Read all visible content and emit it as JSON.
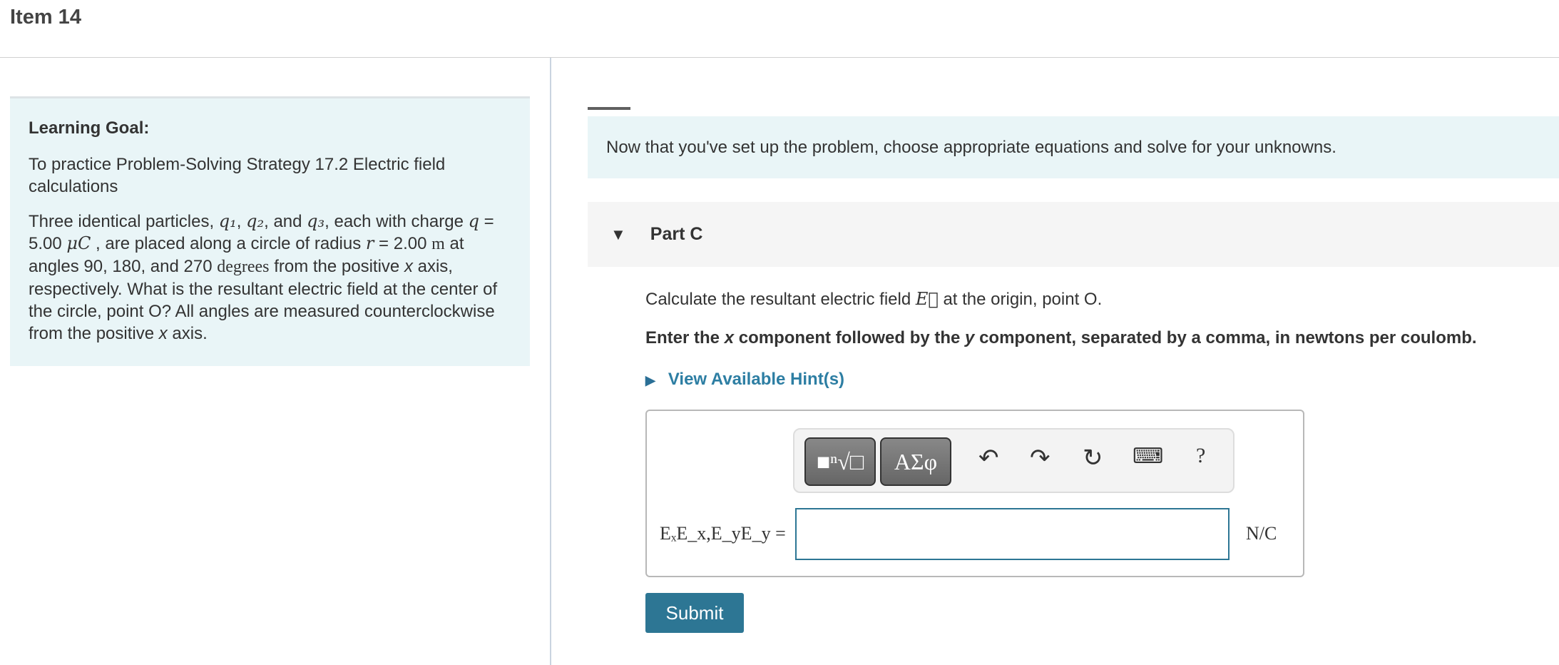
{
  "header": {
    "title": "Item 14"
  },
  "learning_goal": {
    "heading": "Learning Goal:",
    "intro": "To practice Problem-Solving Strategy 17.2 Electric field calculations",
    "problem": {
      "p1": "Three identical particles, ",
      "q1": "q₁",
      "c1": ", ",
      "q2": "q₂",
      "c2": ", and ",
      "q3": "q₃",
      "p2": ", each with charge ",
      "q": "q",
      "p3": " = 5.00 ",
      "unit_c": "μC",
      "p4": " , are placed along a circle of radius ",
      "r": "r",
      "p5": " = 2.00 ",
      "m": "m",
      "p6": " at angles 90, 180, and 270 ",
      "deg": "degrees",
      "p7": " from the positive ",
      "x": "x",
      "p8": " axis, respectively. What is the resultant electric field at the center of the circle, point O? All angles are measured counterclockwise from the positive ",
      "x2": "x",
      "p9": " axis."
    }
  },
  "main": {
    "intro": "Now that you've set up the problem, choose appropriate equations and solve for your unknowns.",
    "part": {
      "label": "Part C",
      "calc_pre": "Calculate the resultant electric field ",
      "calc_sym": "E⃗",
      "calc_post": " at the origin, point O.",
      "enter_a": "Enter the ",
      "enter_x": "x",
      "enter_b": " component followed by the ",
      "enter_y": "y",
      "enter_c": " component, separated by a comma, in newtons per coulomb.",
      "hint": "View Available Hint(s)",
      "toolbar": {
        "templates": "■ⁿ√□",
        "greek": "ΑΣφ",
        "undo": "undo-icon",
        "redo": "redo-icon",
        "reset": "reset-icon",
        "keyboard": "keyboard-icon",
        "help": "?"
      },
      "answer_label": "EₓE_x,E_yE_y =",
      "answer_value": "",
      "unit": "N/C",
      "submit": "Submit"
    }
  },
  "colors": {
    "accent": "#2d7694",
    "panel": "#e9f5f7"
  }
}
